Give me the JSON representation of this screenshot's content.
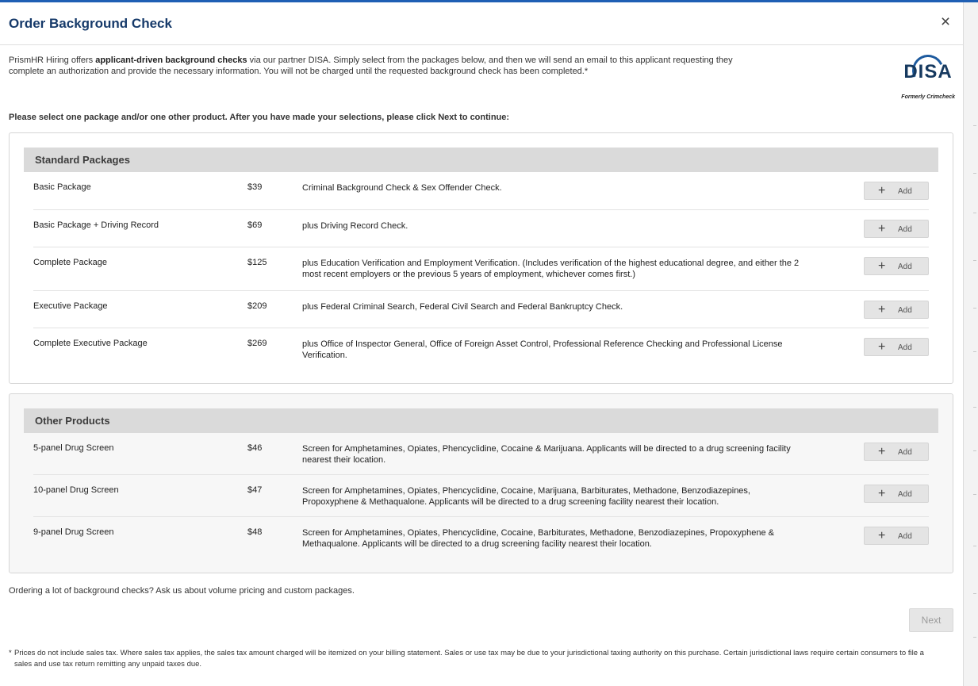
{
  "modal": {
    "title": "Order Background Check",
    "close_icon": "close-icon"
  },
  "intro": {
    "part1": "PrismHR Hiring offers ",
    "bold": "applicant-driven background checks",
    "part2": " via our partner DISA. Simply select from the packages below, and then we will send an email to this applicant requesting they complete an authorization and provide the necessary information. You will not be charged until the requested background check has been completed.*"
  },
  "logo": {
    "name": "DISA",
    "tagline": "Formerly Crimcheck"
  },
  "instruction": "Please select one package and/or one other product. After you have made your selections, please click Next to continue:",
  "standard": {
    "heading": "Standard Packages",
    "items": [
      {
        "name": "Basic Package",
        "price": "$39",
        "desc": "Criminal Background Check & Sex Offender Check.",
        "add": "Add"
      },
      {
        "name": "Basic Package + Driving Record",
        "price": "$69",
        "desc": "plus Driving Record Check.",
        "add": "Add"
      },
      {
        "name": "Complete Package",
        "price": "$125",
        "desc": "plus Education Verification and Employment Verification. (Includes verification of the highest educational degree, and either the 2 most recent employers or the previous 5 years of employment, whichever comes first.)",
        "add": "Add"
      },
      {
        "name": "Executive Package",
        "price": "$209",
        "desc": "plus Federal Criminal Search, Federal Civil Search and Federal Bankruptcy Check.",
        "add": "Add"
      },
      {
        "name": "Complete Executive Package",
        "price": "$269",
        "desc": "plus Office of Inspector General, Office of Foreign Asset Control, Professional Reference Checking and Professional License Verification.",
        "add": "Add"
      }
    ]
  },
  "other": {
    "heading": "Other Products",
    "items": [
      {
        "name": "5-panel Drug Screen",
        "price": "$46",
        "desc": "Screen for Amphetamines, Opiates, Phencyclidine, Cocaine & Marijuana. Applicants will be directed to a drug screening facility nearest their location.",
        "add": "Add"
      },
      {
        "name": "10-panel Drug Screen",
        "price": "$47",
        "desc": "Screen for Amphetamines, Opiates, Phencyclidine, Cocaine, Marijuana, Barbiturates, Methadone, Benzodiazepines, Propoxyphene & Methaqualone. Applicants will be directed to a drug screening facility nearest their location.",
        "add": "Add"
      },
      {
        "name": "9-panel Drug Screen",
        "price": "$48",
        "desc": "Screen for Amphetamines, Opiates, Phencyclidine, Cocaine, Barbiturates, Methadone, Benzodiazepines, Propoxyphene & Methaqualone. Applicants will be directed to a drug screening facility nearest their location.",
        "add": "Add"
      }
    ]
  },
  "volume_text": "Ordering a lot of background checks? Ask us about volume pricing and custom packages.",
  "next_label": "Next",
  "footnote": {
    "asterisk": "*",
    "text": "Prices do not include sales tax. Where sales tax applies, the sales tax amount charged will be itemized on your billing statement. Sales or use tax may be due to your jurisdictional taxing authority on this purchase. Certain jurisdictional laws require certain consumers to file a sales and use tax return remitting any unpaid taxes due."
  },
  "colors": {
    "title": "#163a6a",
    "accent_line": "#1f5fb4",
    "section_header_bg": "#dadada",
    "add_button_bg": "#e4e4e4"
  }
}
